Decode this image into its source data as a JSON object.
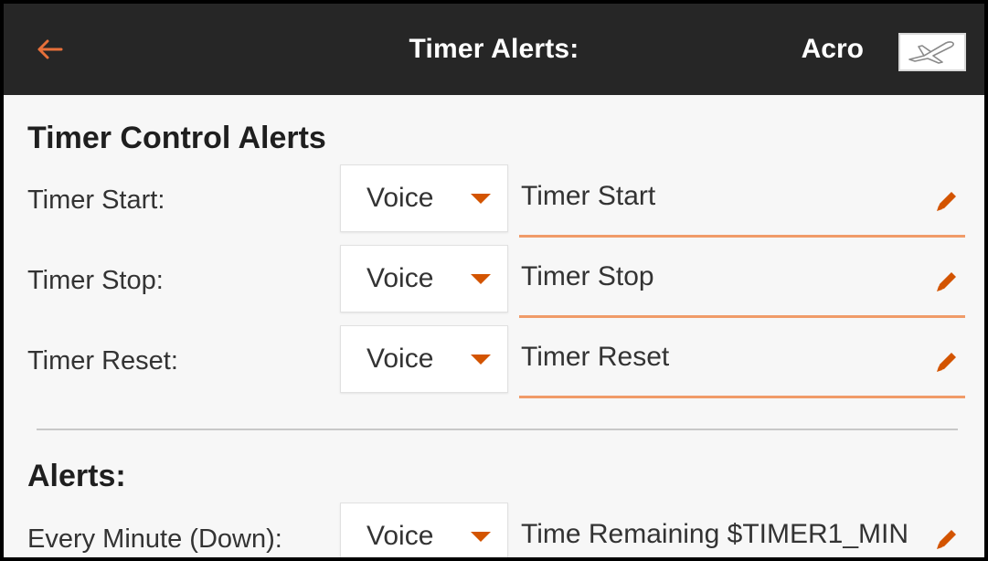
{
  "header": {
    "title": "Timer Alerts:",
    "model_name": "Acro",
    "back_icon": "arrow-left-icon",
    "model_icon": "airplane-icon",
    "background_color": "#262626",
    "accent_color": "#e8703a"
  },
  "timer_control": {
    "heading": "Timer Control Alerts",
    "rows": [
      {
        "label": "Timer Start:",
        "mode": "Voice",
        "text": "Timer Start"
      },
      {
        "label": "Timer Stop:",
        "mode": "Voice",
        "text": "Timer Stop"
      },
      {
        "label": "Timer Reset:",
        "mode": "Voice",
        "text": "Timer Reset"
      }
    ]
  },
  "alerts": {
    "heading": "Alerts:",
    "rows": [
      {
        "label": "Every Minute (Down):",
        "mode": "Voice",
        "text": "Time Remaining $TIMER1_MIN"
      }
    ]
  },
  "icons": {
    "dropdown_caret": "caret-down-icon",
    "edit": "pencil-icon"
  }
}
